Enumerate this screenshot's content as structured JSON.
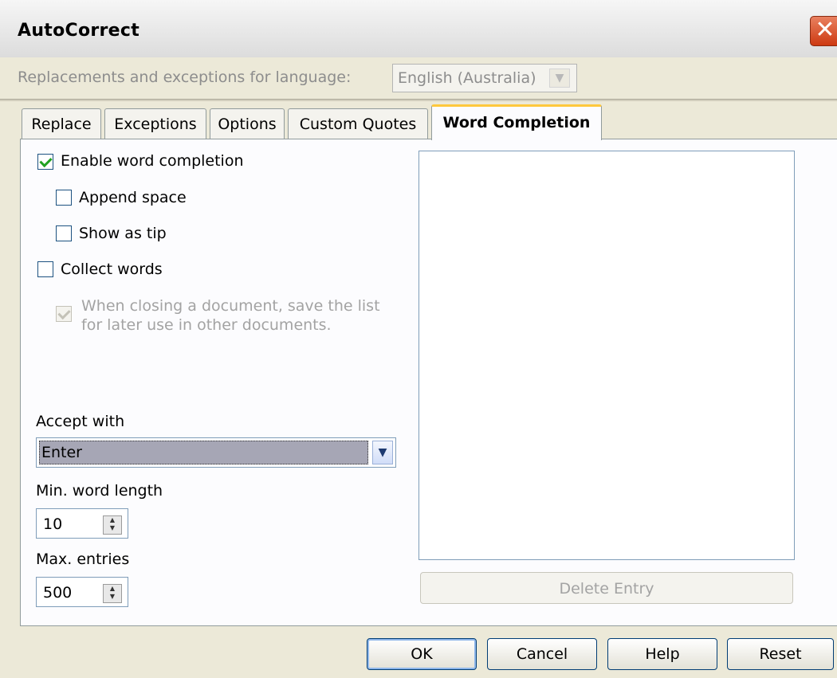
{
  "window": {
    "title": "AutoCorrect",
    "close_label": "✕"
  },
  "language": {
    "label": "Replacements and exceptions for language:",
    "value": "English (Australia)"
  },
  "tabs": [
    {
      "label": "Replace",
      "active": false
    },
    {
      "label": "Exceptions",
      "active": false
    },
    {
      "label": "Options",
      "active": false
    },
    {
      "label": "Custom Quotes",
      "active": false
    },
    {
      "label": "Word Completion",
      "active": true
    }
  ],
  "word_completion": {
    "enable": {
      "label": "Enable word completion",
      "checked": true
    },
    "append_space": {
      "label": "Append space",
      "checked": false
    },
    "show_as_tip": {
      "label": "Show as tip",
      "checked": false
    },
    "collect_words": {
      "label": "Collect words",
      "checked": false
    },
    "save_list": {
      "label_line1": "When closing a document, save the list",
      "label_line2": "for later use in other documents.",
      "checked": true,
      "disabled": true
    },
    "accept_with": {
      "label": "Accept with",
      "value": "Enter"
    },
    "min_word_length": {
      "label": "Min. word length",
      "value": "10"
    },
    "max_entries": {
      "label": "Max. entries",
      "value": "500"
    },
    "word_list": [],
    "delete_entry_label": "Delete Entry"
  },
  "buttons": {
    "ok": "OK",
    "cancel": "Cancel",
    "help": "Help",
    "reset": "Reset"
  }
}
